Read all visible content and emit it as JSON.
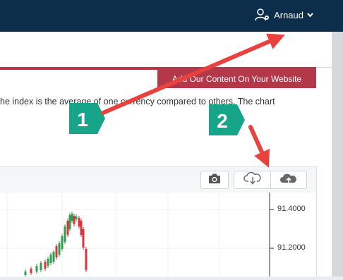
{
  "header": {
    "username": "Arnaud",
    "icons": {
      "user": "user-settings-icon",
      "caret": "chevron-down-icon"
    }
  },
  "embed_button": {
    "label": "Add Our Content On Your Website"
  },
  "description": {
    "text": "he index is the average of one currency compared to others. The chart"
  },
  "toolbar": {
    "icons": [
      "camera-icon",
      "cloud-download-icon",
      "cloud-upload-icon"
    ]
  },
  "annotations": {
    "badge1": "1",
    "badge2": "2"
  },
  "chart_data": {
    "type": "candlestick",
    "y_ticks": [
      "91.4000",
      "91.2000"
    ],
    "colors": {
      "up": "#2e9e4f",
      "down": "#d9343b"
    }
  },
  "colors": {
    "accent": "#b2384a",
    "topbar": "#0d2e4a",
    "badge": "#17a589",
    "arrow": "#e8413e"
  }
}
